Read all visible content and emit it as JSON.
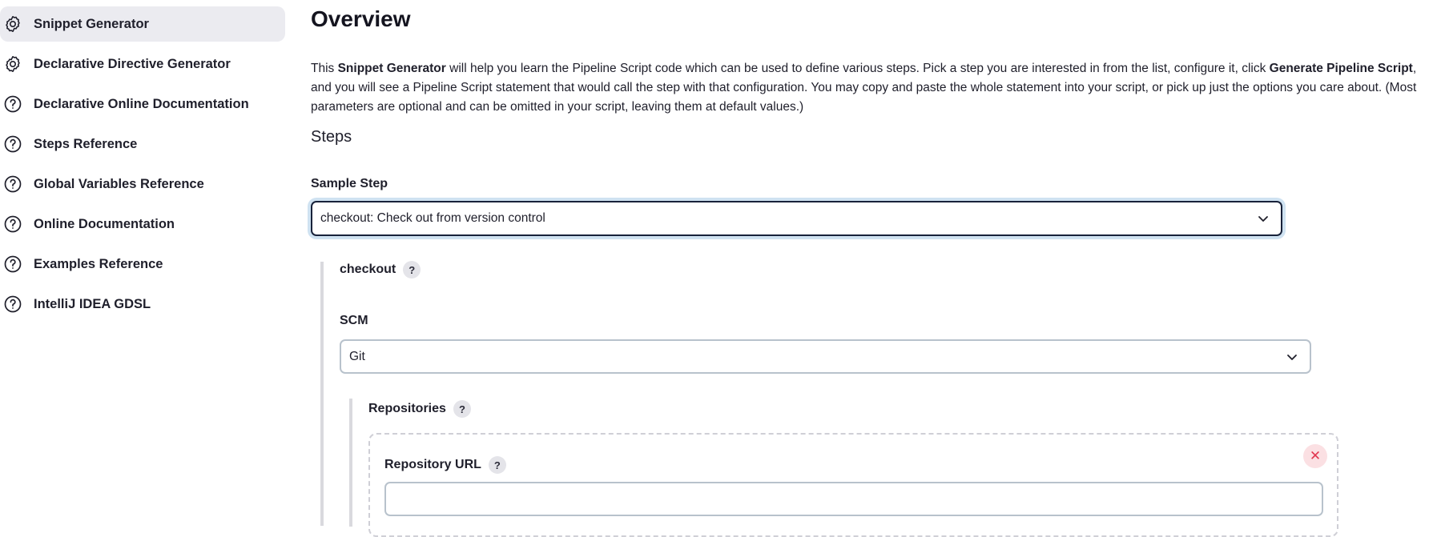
{
  "sidebar": {
    "items": [
      {
        "label": "Snippet Generator",
        "icon": "gear-icon",
        "active": true
      },
      {
        "label": "Declarative Directive Generator",
        "icon": "gear-icon",
        "active": false
      },
      {
        "label": "Declarative Online Documentation",
        "icon": "help-circle-icon",
        "active": false
      },
      {
        "label": "Steps Reference",
        "icon": "help-circle-icon",
        "active": false
      },
      {
        "label": "Global Variables Reference",
        "icon": "help-circle-icon",
        "active": false
      },
      {
        "label": "Online Documentation",
        "icon": "help-circle-icon",
        "active": false
      },
      {
        "label": "Examples Reference",
        "icon": "help-circle-icon",
        "active": false
      },
      {
        "label": "IntelliJ IDEA GDSL",
        "icon": "help-circle-icon",
        "active": false
      }
    ]
  },
  "main": {
    "title": "Overview",
    "description": {
      "part1": "This ",
      "bold1": "Snippet Generator",
      "part2": " will help you learn the Pipeline Script code which can be used to define various steps. Pick a step you are interested in from the list, configure it, click ",
      "bold2": "Generate Pipeline Script",
      "part3": ", and you will see a Pipeline Script statement that would call the step with that configuration. You may copy and paste the whole statement into your script, or pick up just the options you care about. (Most parameters are optional and can be omitted in your script, leaving them at default values.)"
    },
    "steps_heading": "Steps",
    "sample_step": {
      "label": "Sample Step",
      "selected": "checkout: Check out from version control"
    },
    "checkout": {
      "label": "checkout",
      "help": "?"
    },
    "scm": {
      "label": "SCM",
      "selected": "Git"
    },
    "repositories": {
      "label": "Repositories",
      "help": "?",
      "delete_symbol": "✕",
      "repository_url": {
        "label": "Repository URL",
        "help": "?",
        "value": ""
      }
    }
  },
  "colors": {
    "active_bg": "#ebebf0",
    "focus_ring": "#cfe2f1",
    "delete_bg": "#fbe0e3",
    "delete_fg": "#e1364f"
  }
}
